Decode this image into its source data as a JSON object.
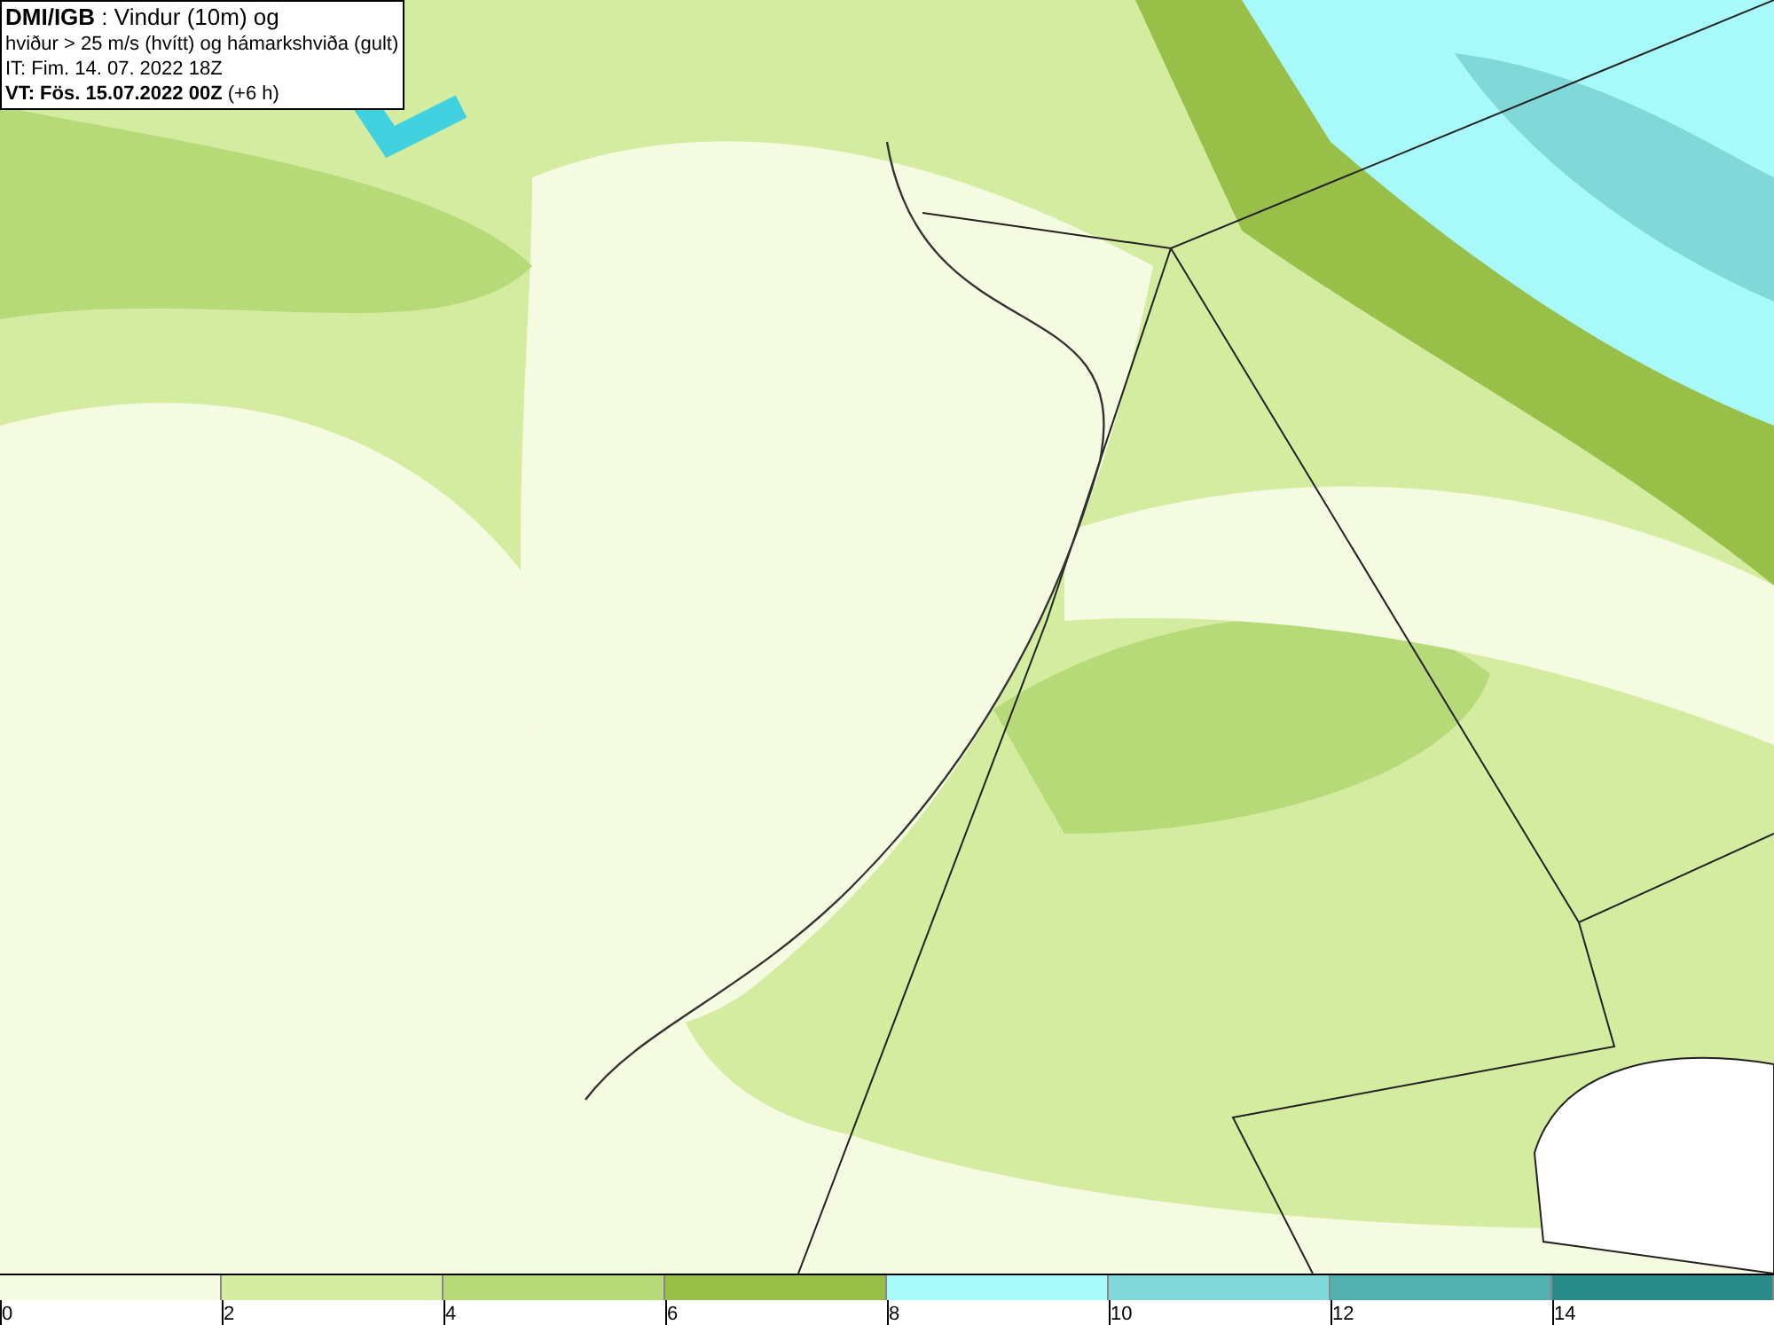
{
  "header": {
    "lines": [
      "**DMI/IGB** : Vindur (10m) og",
      "hviður > 25 m/s (hvítt) og hámarkshviða (gult)",
      "IT: Fim. 14. 07. 2022 18Z",
      "**VT: Fös. 15.07.2022 00Z** (+6 h)"
    ]
  },
  "colorbar": [
    {
      "label": "0",
      "color": "#f5fbe0"
    },
    {
      "label": "2",
      "color": "#d4eca0"
    },
    {
      "label": "4",
      "color": "#b7da78"
    },
    {
      "label": "6",
      "color": "#98bf48"
    },
    {
      "label": "8",
      "color": "#a8fafa"
    },
    {
      "label": "10",
      "color": "#80d8d8"
    },
    {
      "label": "12",
      "color": "#52b0b0"
    },
    {
      "label": "14",
      "color": "#2a8c88"
    }
  ]
}
